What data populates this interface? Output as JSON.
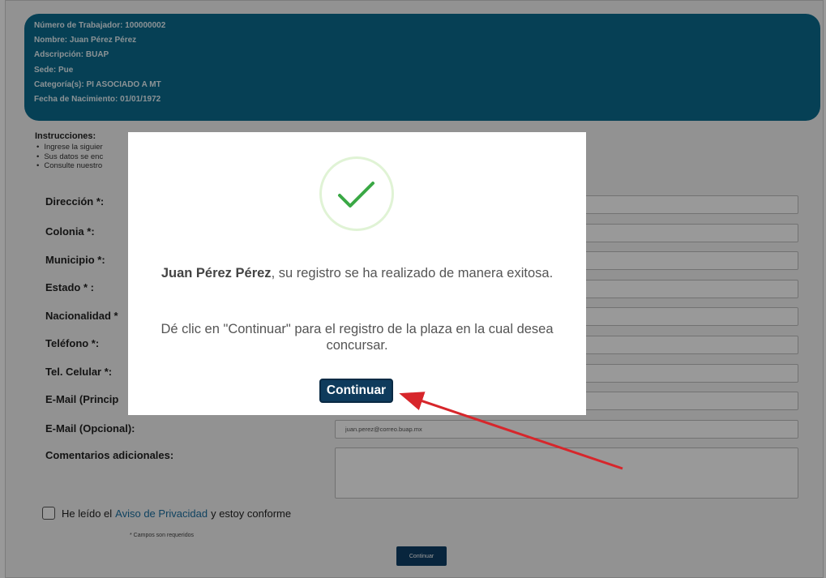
{
  "worker": {
    "numero": "Número de Trabajador: 100000002",
    "nombre": "Nombre: Juan Pérez Pérez",
    "adscripcion": "Adscripción: BUAP",
    "sede": "Sede: Pue",
    "categoria": "Categoría(s): PI ASOCIADO A MT",
    "fecha": "Fecha de Nacimiento: 01/01/1972"
  },
  "instructions": {
    "title": "Instrucciones:",
    "items": [
      "Ingrese la siguier",
      "Sus datos se enc",
      "Consulte nuestro"
    ]
  },
  "form": {
    "direccion": "Dirección *:",
    "colonia": "Colonia *:",
    "municipio": "Municipio *:",
    "estado": "Estado * :",
    "nacionalidad": "Nacionalidad *",
    "telefono": "Teléfono *:",
    "celular": "Tel. Celular *:",
    "email_principal": "E-Mail (Princip",
    "email_opcional": "E-Mail (Opcional):",
    "email_opcional_value": "juan.perez@correo.buap.mx",
    "comentarios": "Comentarios adicionales:",
    "privacy_before": "He leído el",
    "privacy_link": "Aviso de Privacidad",
    "privacy_after": "y estoy conforme",
    "required_note": "* Campos son requeridos",
    "continue": "Continuar"
  },
  "modal": {
    "name": "Juan Pérez Pérez",
    "message": ", su registro se ha realizado de manera exitosa.",
    "instruction": "Dé clic en \"Continuar\" para el registro de la plaza en la cual desea concursar.",
    "button": "Continuar",
    "icon": "check-icon"
  },
  "colors": {
    "header_bg": "#0b6b8e",
    "button_bg": "#0f3b5c",
    "arrow": "#d7262b",
    "check": "#3aa845"
  }
}
